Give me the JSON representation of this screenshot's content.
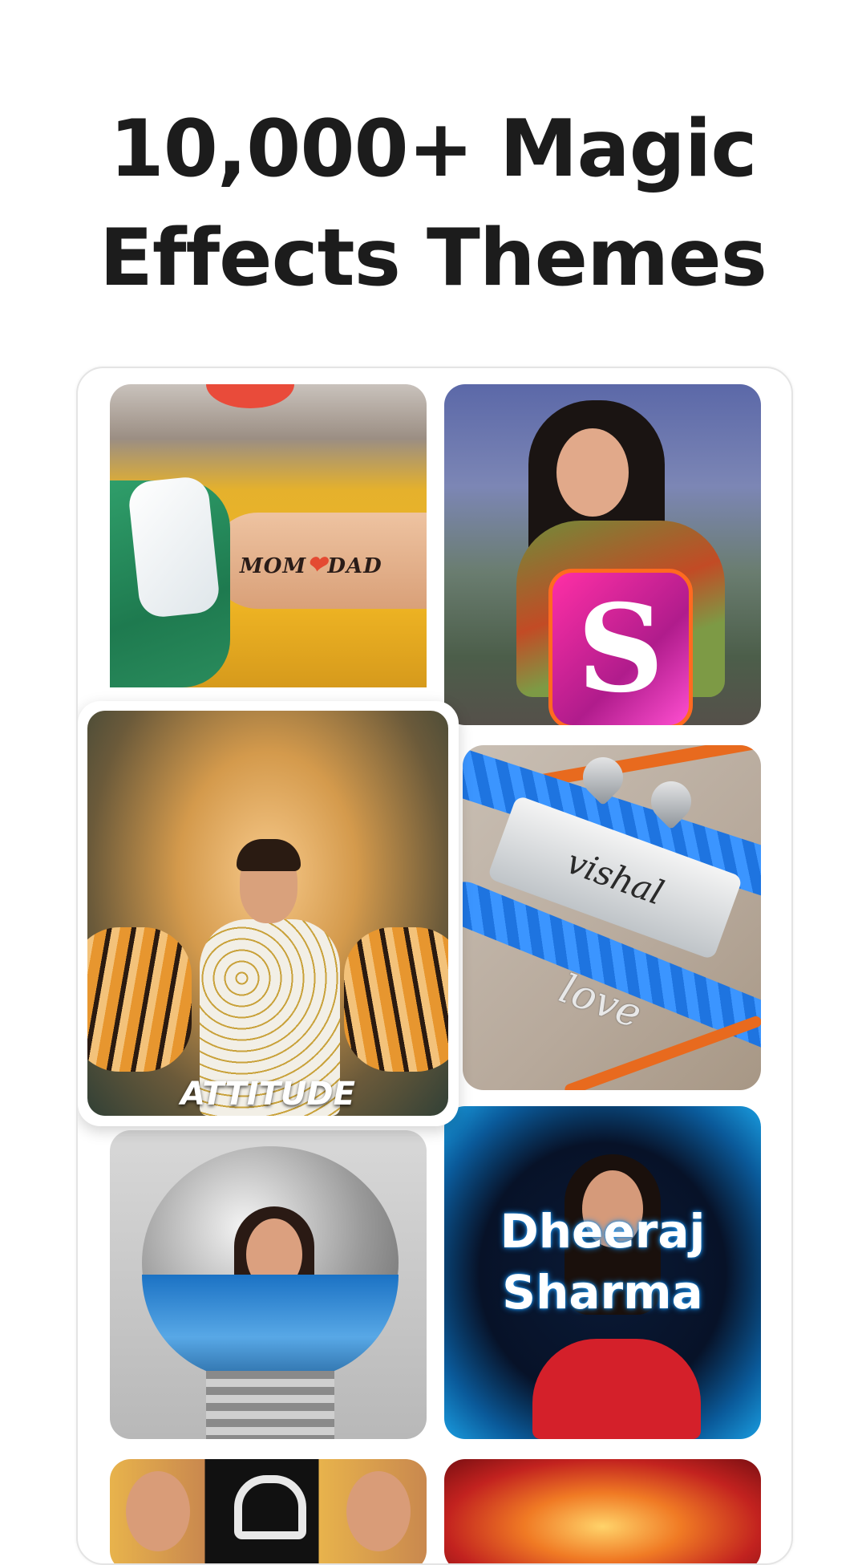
{
  "headline": {
    "line1": "10,000+ Magic",
    "line2": "Effects Themes"
  },
  "tiles": {
    "tattoo": {
      "text": "MOM",
      "heart": "❤",
      "text2": "DAD"
    },
    "letter": {
      "text": "S"
    },
    "attitude": {
      "caption": "ATTITUDE"
    },
    "bracelet": {
      "name": "vishal",
      "word": "love"
    },
    "name_card": {
      "line1": "Dheeraj",
      "line2": "Sharma"
    }
  },
  "colors": {
    "headline": "#1c1c1c",
    "frame_border": "#e4e4e4",
    "background": "#ffffff"
  }
}
